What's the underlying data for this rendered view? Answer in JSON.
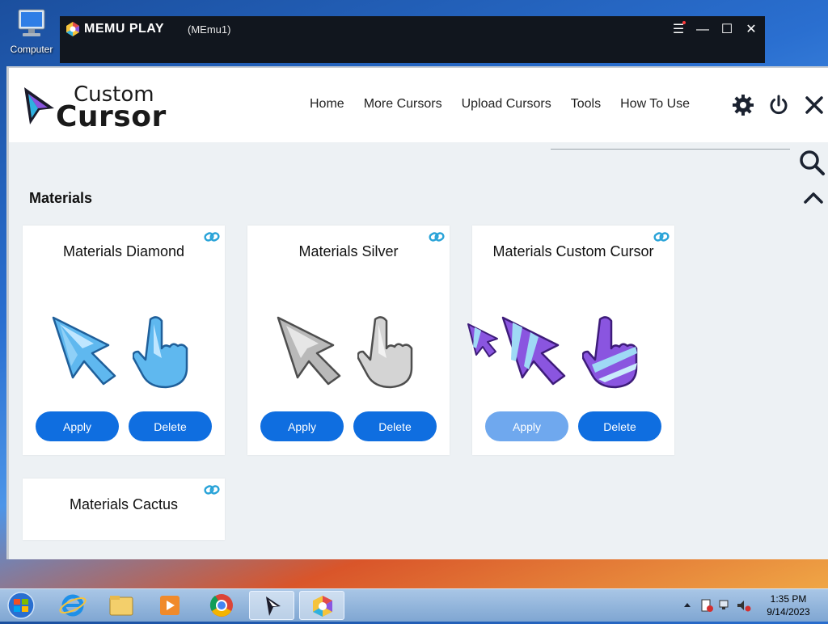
{
  "desktop": {
    "computer_label": "Computer"
  },
  "emulator": {
    "title": "MEMU PLAY",
    "instance": "(MEmu1)"
  },
  "app": {
    "brand": {
      "line1": "Custom",
      "line2": "Cursor"
    },
    "nav": [
      "Home",
      "More Cursors",
      "Upload Cursors",
      "Tools",
      "How To Use"
    ],
    "header_icons": [
      "gear-icon",
      "power-icon",
      "close-icon"
    ],
    "search_icon": "search-icon",
    "section": {
      "title": "Materials",
      "collapse_icon": "chevron-up-icon"
    },
    "cards": [
      {
        "title": "Materials Diamond",
        "apply": "Apply",
        "delete": "Delete",
        "apply_state": "enabled",
        "color": "#5fb8ef"
      },
      {
        "title": "Materials Silver",
        "apply": "Apply",
        "delete": "Delete",
        "apply_state": "enabled",
        "color": "#b9b9b9"
      },
      {
        "title": "Materials Custom Cursor",
        "apply": "Apply",
        "delete": "Delete",
        "apply_state": "disabled",
        "color": "#8a55e0"
      },
      {
        "title": "Materials Cactus"
      }
    ]
  },
  "taskbar": {
    "apps": [
      "internet-explorer-icon",
      "file-explorer-icon",
      "media-player-icon",
      "chrome-icon",
      "custom-cursor-icon",
      "memu-icon"
    ],
    "clock": {
      "time": "1:35 PM",
      "date": "9/14/2023"
    }
  },
  "colors": {
    "accent": "#0f6ee0",
    "accent_disabled": "#6fa8ee",
    "link": "#29a3d8"
  }
}
